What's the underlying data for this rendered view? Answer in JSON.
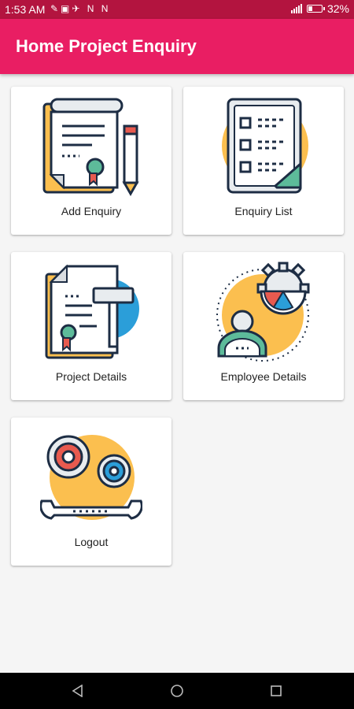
{
  "status_bar": {
    "time": "1:53 AM",
    "notification_glyphs": "✎▣✈ N N",
    "battery_percent": "32%",
    "battery_level": 0.32
  },
  "app_bar": {
    "title": "Home Project Enquiry"
  },
  "cards": [
    {
      "label": "Add Enquiry",
      "icon": "add-enquiry-icon"
    },
    {
      "label": "Enquiry List",
      "icon": "enquiry-list-icon"
    },
    {
      "label": "Project Details",
      "icon": "project-details-icon"
    },
    {
      "label": "Employee Details",
      "icon": "employee-details-icon"
    },
    {
      "label": "Logout",
      "icon": "logout-icon"
    }
  ],
  "colors": {
    "status_bar": "#b3143f",
    "app_bar": "#e91e63",
    "background": "#f5f5f5",
    "icon_orange": "#fbbf4f",
    "icon_blue": "#2b9ed9",
    "icon_red": "#e85a4f",
    "icon_teal": "#5dbb9a"
  },
  "nav_bar": {
    "icons": [
      "back-icon",
      "home-icon",
      "recents-icon"
    ]
  }
}
